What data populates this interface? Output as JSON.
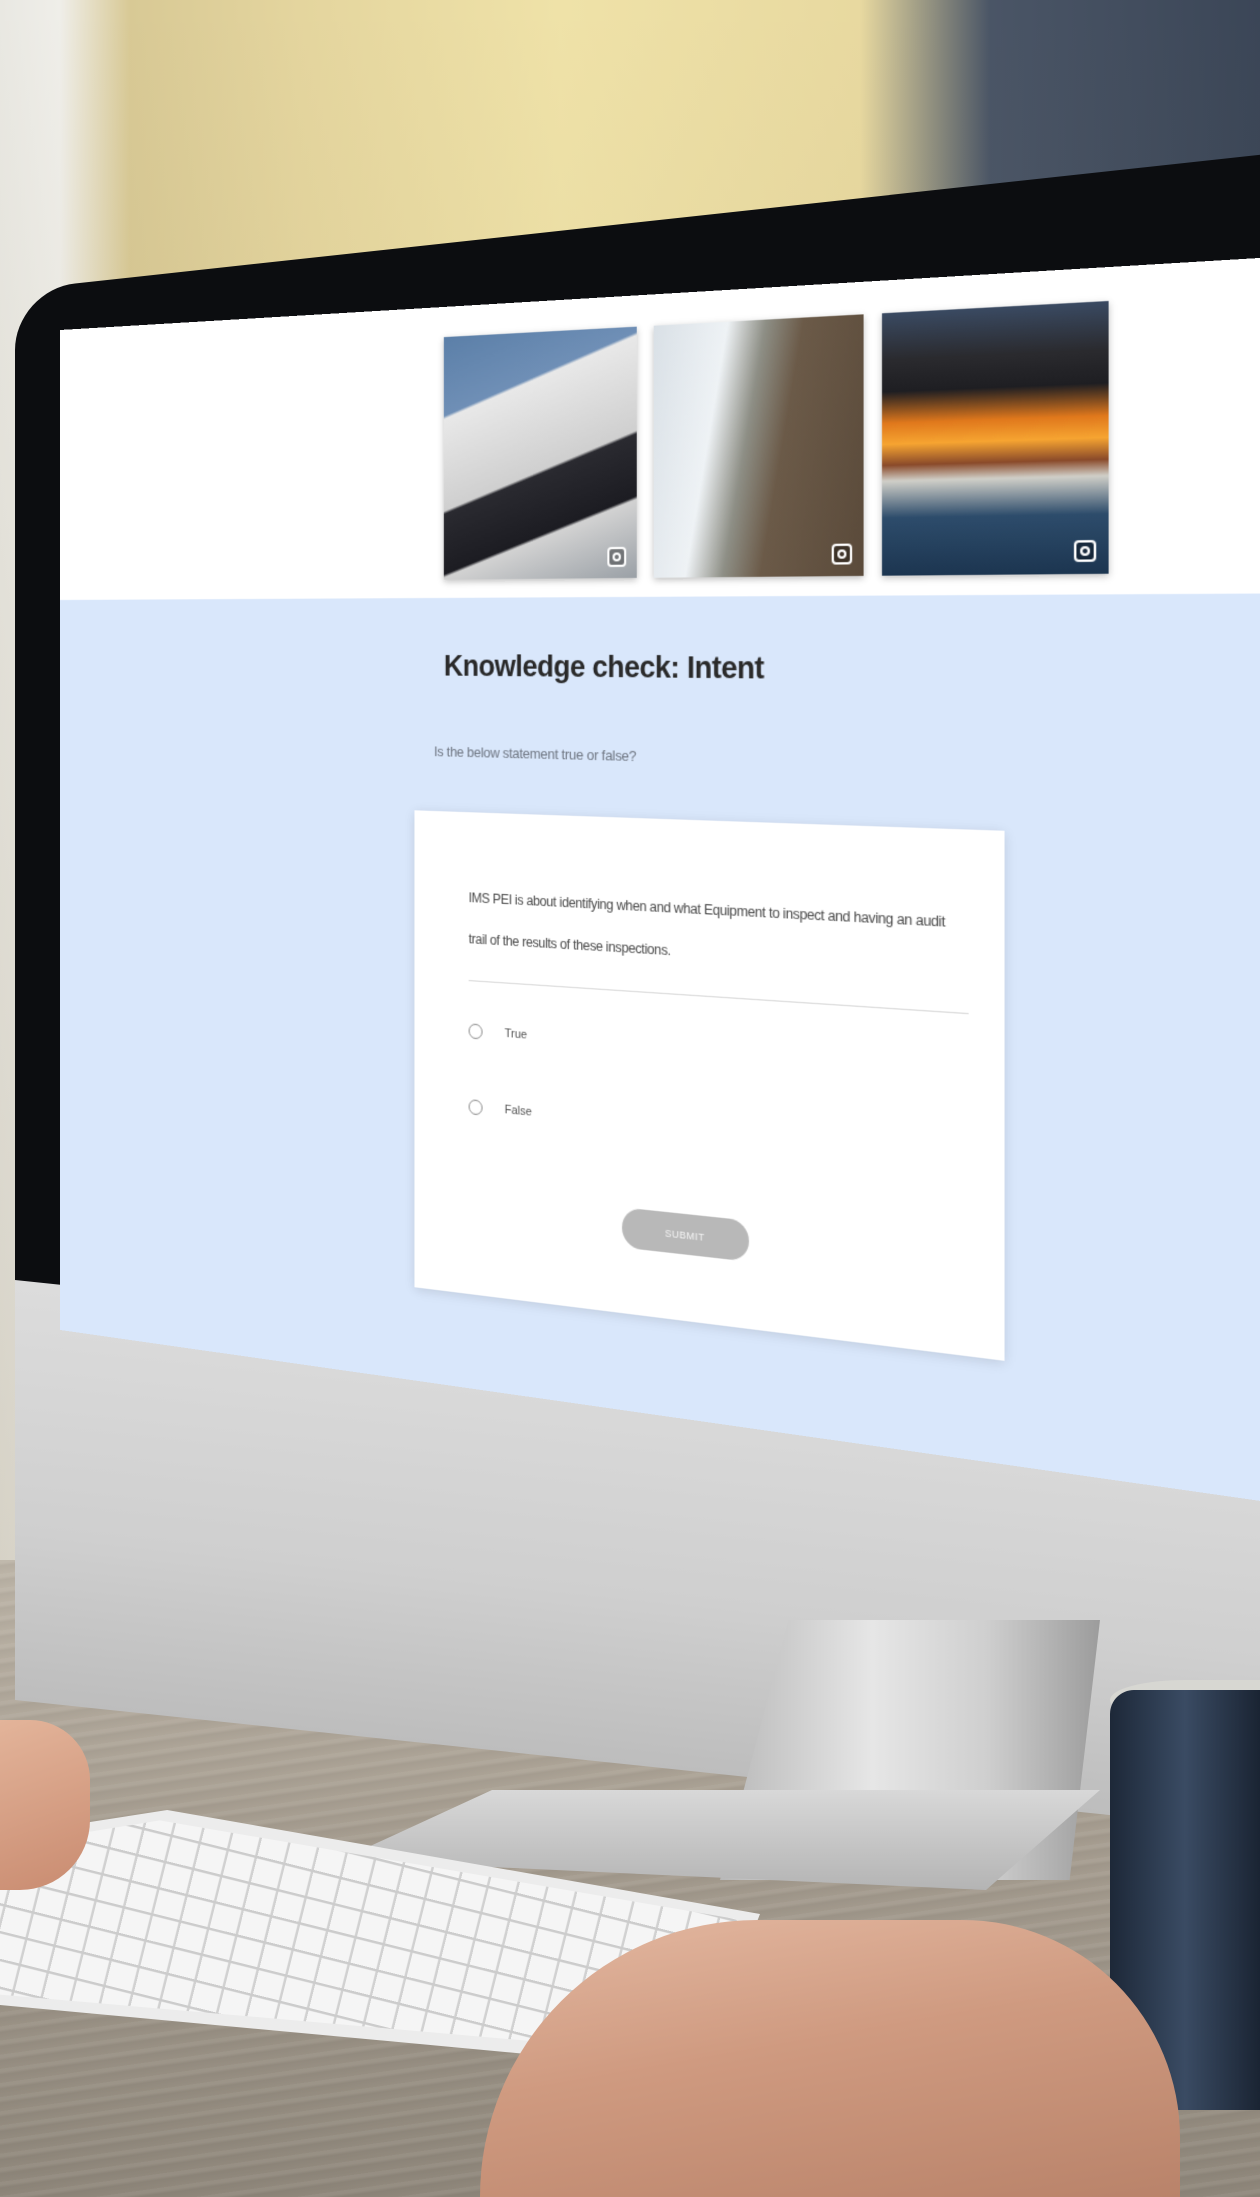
{
  "screen": {
    "title": "Knowledge check: Intent",
    "instruction": "Is the below statement true or false?",
    "question": "IMS PEI is about identifying when and what Equipment to inspect and having an audit trail of the results of these inspections.",
    "options": [
      {
        "label": "True"
      },
      {
        "label": "False"
      }
    ],
    "submit_label": "SUBMIT",
    "gallery": [
      {
        "icon": "zoom-icon"
      },
      {
        "icon": "zoom-icon"
      },
      {
        "icon": "zoom-icon"
      }
    ]
  },
  "colors": {
    "screen_background": "#d9e7fb",
    "card_background": "#ffffff",
    "submit_button": "#b8b8b8",
    "title_text": "#2a2a2a"
  }
}
